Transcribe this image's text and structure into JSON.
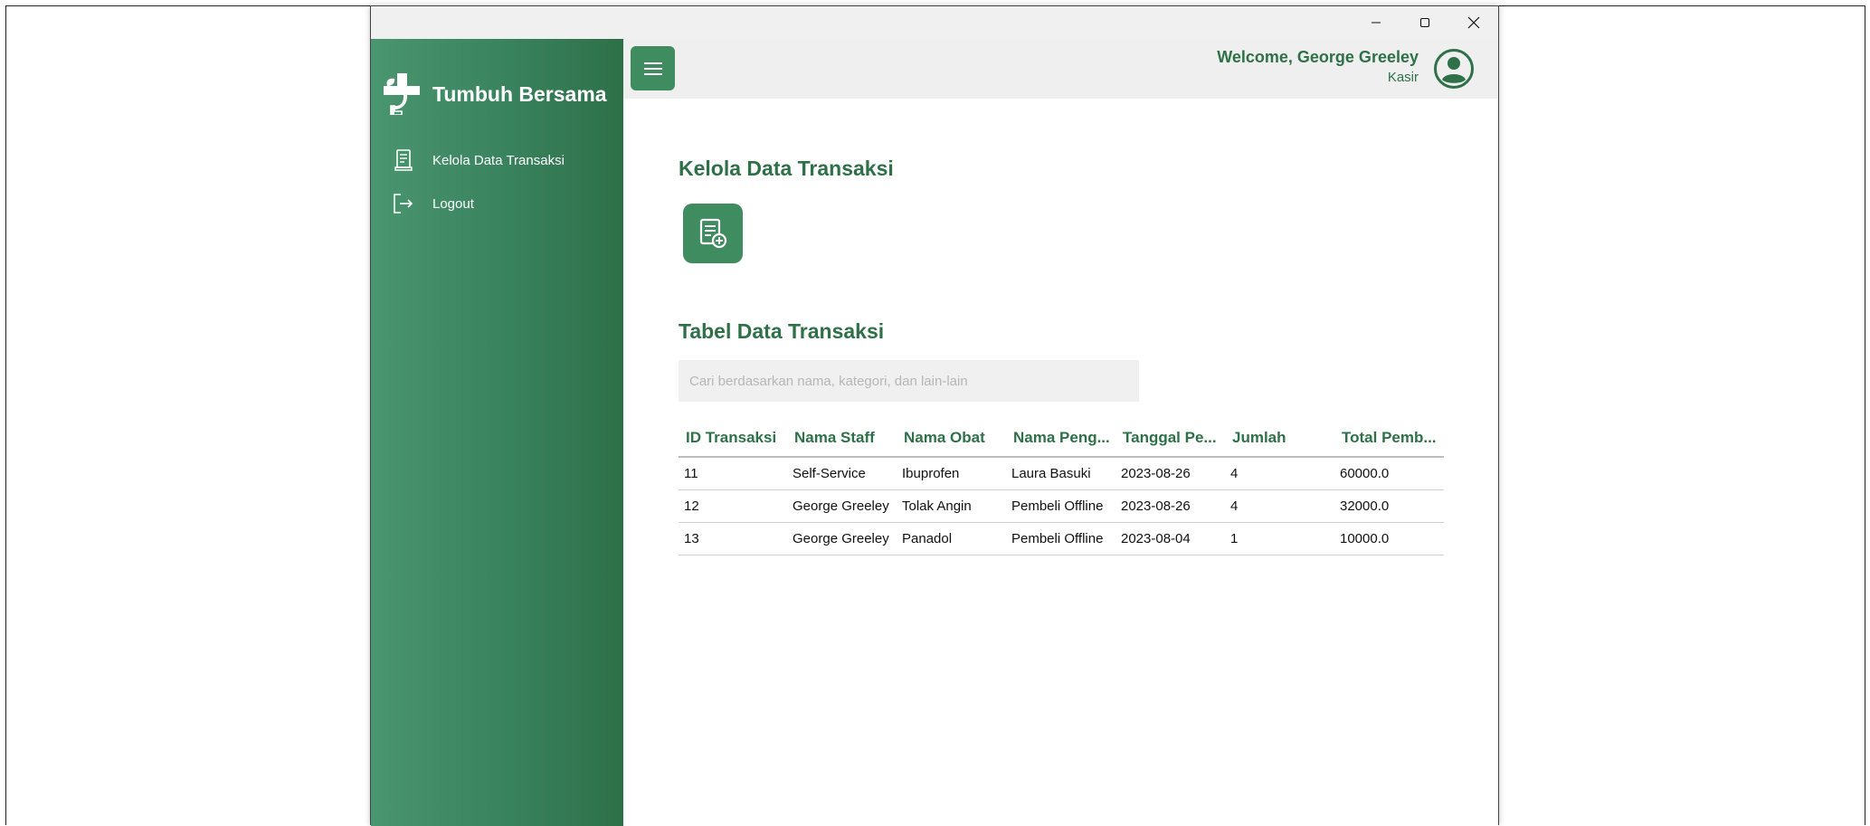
{
  "window": {
    "controls": {
      "minimize": "minimize-icon",
      "maximize": "maximize-icon",
      "close": "close-icon"
    }
  },
  "sidebar": {
    "brand": "Tumbuh Bersama",
    "items": [
      {
        "label": "Kelola Data Transaksi",
        "icon": "receipt-icon"
      },
      {
        "label": "Logout",
        "icon": "logout-icon"
      }
    ]
  },
  "header": {
    "welcome": "Welcome, George Greeley",
    "role": "Kasir"
  },
  "main": {
    "title": "Kelola Data Transaksi",
    "table_title": "Tabel Data Transaksi",
    "search_placeholder": "Cari berdasarkan nama, kategori, dan lain-lain",
    "columns": [
      "ID Transaksi",
      "Nama Staff",
      "Nama Obat",
      "Nama Peng...",
      "Tanggal Pe...",
      "Jumlah",
      "Total Pemb..."
    ],
    "rows": [
      [
        "11",
        "Self-Service",
        "Ibuprofen",
        "Laura Basuki",
        "2023-08-26",
        "4",
        "60000.0"
      ],
      [
        "12",
        "George Greeley",
        "Tolak Angin",
        "Pembeli Offline",
        "2023-08-26",
        "4",
        "32000.0"
      ],
      [
        "13",
        "George Greeley",
        "Panadol",
        "Pembeli Offline",
        "2023-08-04",
        "1",
        "10000.0"
      ]
    ]
  },
  "colors": {
    "accent": "#3e8c60",
    "dark_accent": "#2e7048",
    "header_bg": "#efefef"
  }
}
